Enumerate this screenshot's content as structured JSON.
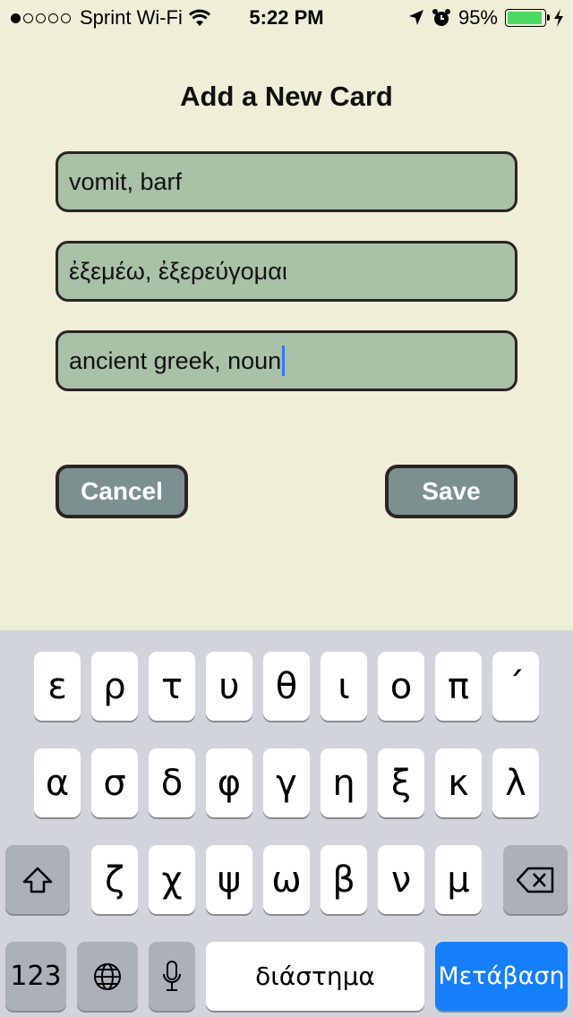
{
  "status_bar": {
    "carrier": "Sprint Wi-Fi",
    "time": "5:22 PM",
    "battery": "95%",
    "battery_level": 0.95,
    "signal_dots_filled": 1,
    "signal_dots_total": 5
  },
  "form": {
    "title": "Add a New Card",
    "fields": [
      {
        "value": "vomit, barf"
      },
      {
        "value": "ἐξεμέω, ἐξερεύγομαι"
      },
      {
        "value": "ancient greek, noun"
      }
    ],
    "cancel_label": "Cancel",
    "save_label": "Save"
  },
  "keyboard": {
    "row1": [
      "ε",
      "ρ",
      "τ",
      "υ",
      "θ",
      "ι",
      "ο",
      "π",
      "´"
    ],
    "row2": [
      "α",
      "σ",
      "δ",
      "φ",
      "γ",
      "η",
      "ξ",
      "κ",
      "λ"
    ],
    "row3": [
      "ζ",
      "χ",
      "ψ",
      "ω",
      "β",
      "ν",
      "μ"
    ],
    "numbers_label": "123",
    "space_label": "διάστημα",
    "return_label": "Μετάβαση"
  },
  "colors": {
    "background": "#efefd8",
    "field_fill": "#a8c1a7",
    "button_fill": "#7b9190",
    "border": "#2e2222",
    "return_key": "#147efb",
    "caret": "#3478f6",
    "battery_fill": "#4cd964"
  },
  "icons": [
    "wifi-icon",
    "location-arrow-icon",
    "alarm-clock-icon",
    "battery-icon",
    "charging-bolt-icon",
    "shift-icon",
    "delete-icon",
    "globe-icon",
    "microphone-icon"
  ]
}
